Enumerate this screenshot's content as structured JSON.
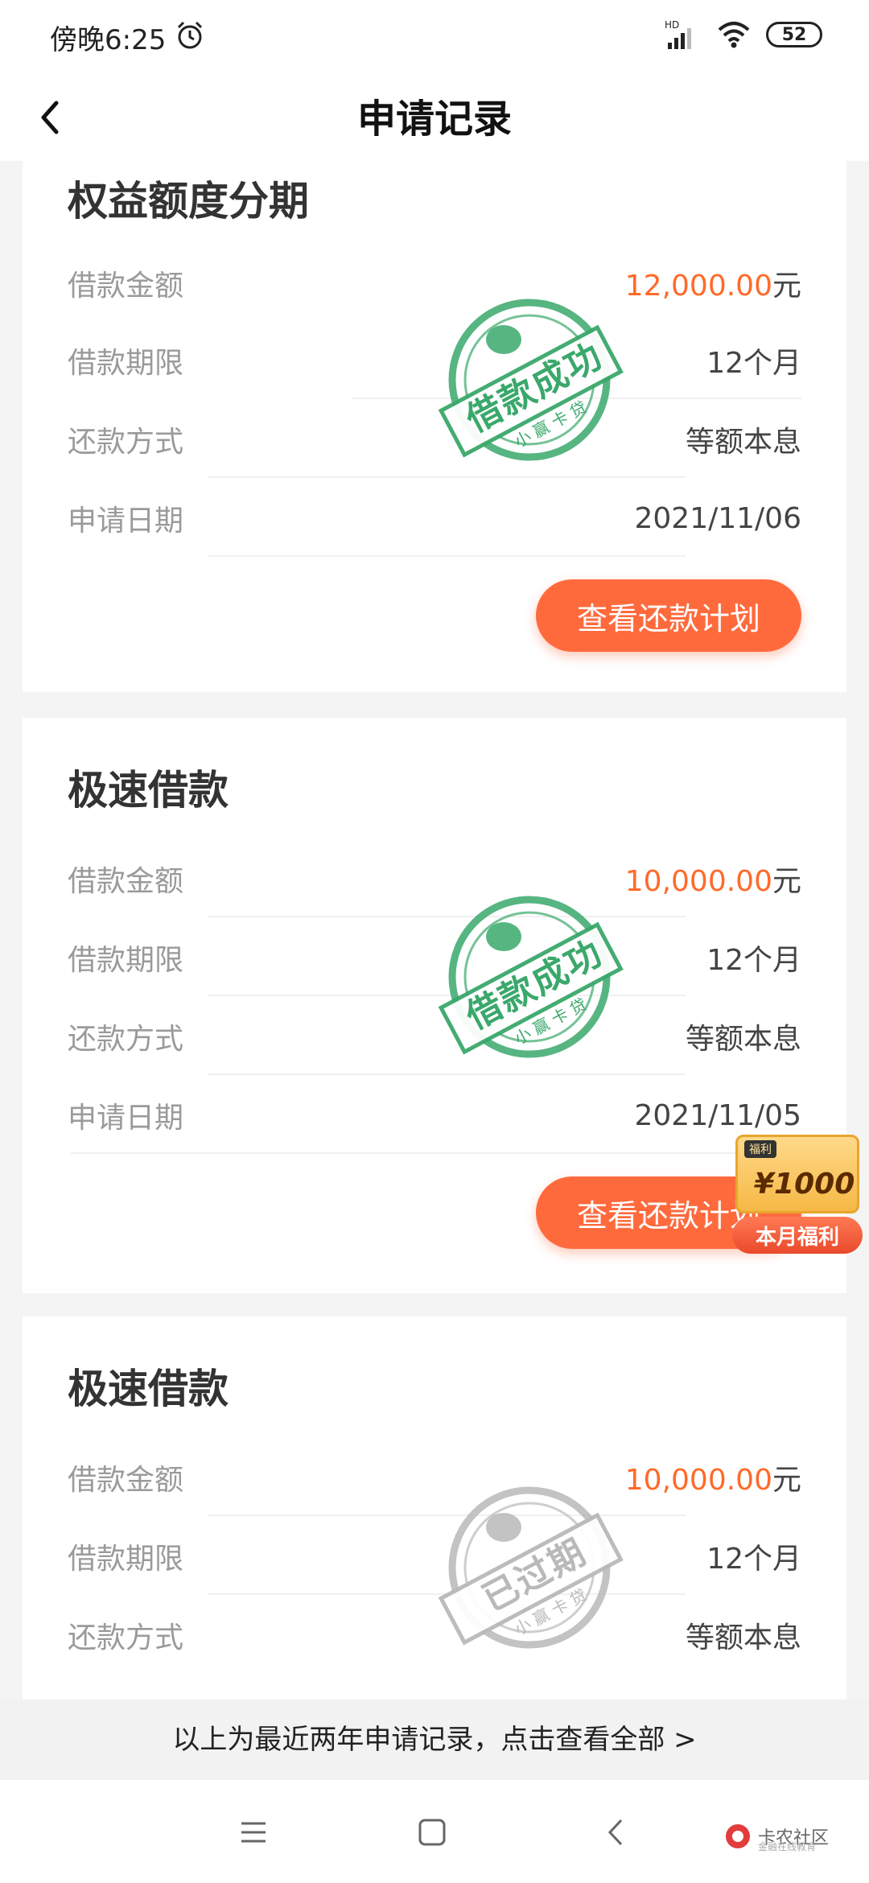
{
  "status_bar": {
    "time": "傍晚6:25",
    "network": "HD",
    "battery": "52"
  },
  "header": {
    "title": "申请记录"
  },
  "labels": {
    "amount": "借款金额",
    "term": "借款期限",
    "method": "还款方式",
    "date": "申请日期",
    "unit": "元"
  },
  "records": [
    {
      "product": "权益额度分期",
      "amount": "12,000.00",
      "term": "12个月",
      "method": "等额本息",
      "date": "2021/11/06",
      "button": "查看还款计划",
      "stamp": "借款成功",
      "stamp_brand": "小赢卡贷"
    },
    {
      "product": "极速借款",
      "amount": "10,000.00",
      "term": "12个月",
      "method": "等额本息",
      "date": "2021/11/05",
      "button": "查看还款计划",
      "stamp": "借款成功",
      "stamp_brand": "小赢卡贷"
    },
    {
      "product": "极速借款",
      "amount": "10,000.00",
      "term": "12个月",
      "method": "等额本息",
      "stamp": "已过期",
      "stamp_brand": "小赢卡贷"
    }
  ],
  "promo": {
    "tag": "福利",
    "amount": "¥1000",
    "label": "本月福利"
  },
  "footer": {
    "notice": "以上为最近两年申请记录，点击查看全部 >"
  },
  "watermark": {
    "text": "卡农社区",
    "sub": "金融在线教育"
  },
  "colors": {
    "accent": "#ff6a3d",
    "amount": "#ff6a2a",
    "stamp_success": "#3aa86b",
    "stamp_expired": "#b9b9b9"
  }
}
